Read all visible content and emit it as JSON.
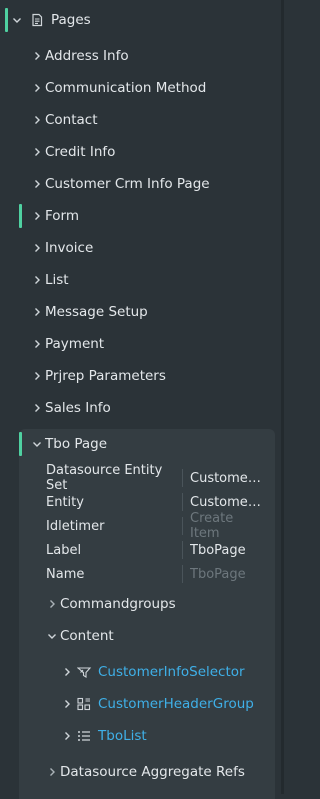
{
  "root": {
    "label": "Pages",
    "icon": "page-icon"
  },
  "pages": [
    {
      "label": "Address Info",
      "highlight": false
    },
    {
      "label": "Communication Method",
      "highlight": false
    },
    {
      "label": "Contact",
      "highlight": false
    },
    {
      "label": "Credit Info",
      "highlight": false
    },
    {
      "label": "Customer Crm Info Page",
      "highlight": false
    },
    {
      "label": "Form",
      "highlight": true
    },
    {
      "label": "Invoice",
      "highlight": false
    },
    {
      "label": "List",
      "highlight": false
    },
    {
      "label": "Message Setup",
      "highlight": false
    },
    {
      "label": "Payment",
      "highlight": false
    },
    {
      "label": "Prjrep Parameters",
      "highlight": false
    },
    {
      "label": "Sales Info",
      "highlight": false
    }
  ],
  "tbo": {
    "label": "Tbo Page",
    "properties": [
      {
        "name": "Datasource Entity Set",
        "value": "CustomerInfoSet",
        "muted": false
      },
      {
        "name": "Entity",
        "value": "CustomerInfo",
        "muted": false
      },
      {
        "name": "Idletimer",
        "value": "Create Item",
        "muted": true
      },
      {
        "name": "Label",
        "value": "TboPage",
        "muted": false
      },
      {
        "name": "Name",
        "value": "TboPage",
        "muted": true
      }
    ],
    "commandgroups": {
      "label": "Commandgroups"
    },
    "content": {
      "label": "Content",
      "children": [
        {
          "label": "CustomerInfoSelector",
          "icon": "selector-icon"
        },
        {
          "label": "CustomerHeaderGroup",
          "icon": "group-icon"
        },
        {
          "label": "TboList",
          "icon": "list-icon"
        }
      ]
    },
    "datasource_aggregate_refs": {
      "label": "Datasource Aggregate Refs"
    }
  },
  "colors": {
    "background": "#2b3338",
    "panel": "#343d42",
    "accent_marker": "#4fd1a1",
    "link": "#3fb0e8",
    "muted": "#6d777d"
  }
}
